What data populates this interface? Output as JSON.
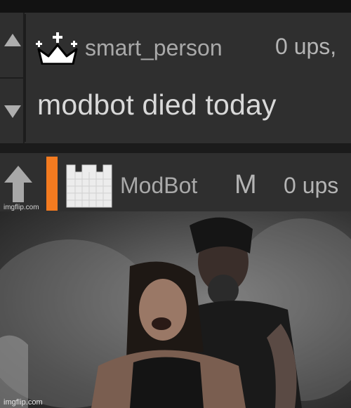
{
  "comment": {
    "username": "smart_person",
    "ups": "0 ups,",
    "text": "modbot died today"
  },
  "reply": {
    "username": "ModBot",
    "badge": "M",
    "ups": "0 ups"
  },
  "watermarks": {
    "top": "imgflip.com",
    "bottom": "imgflip.com"
  },
  "colors": {
    "accent": "#f47b20",
    "background": "#2f2f2f"
  }
}
